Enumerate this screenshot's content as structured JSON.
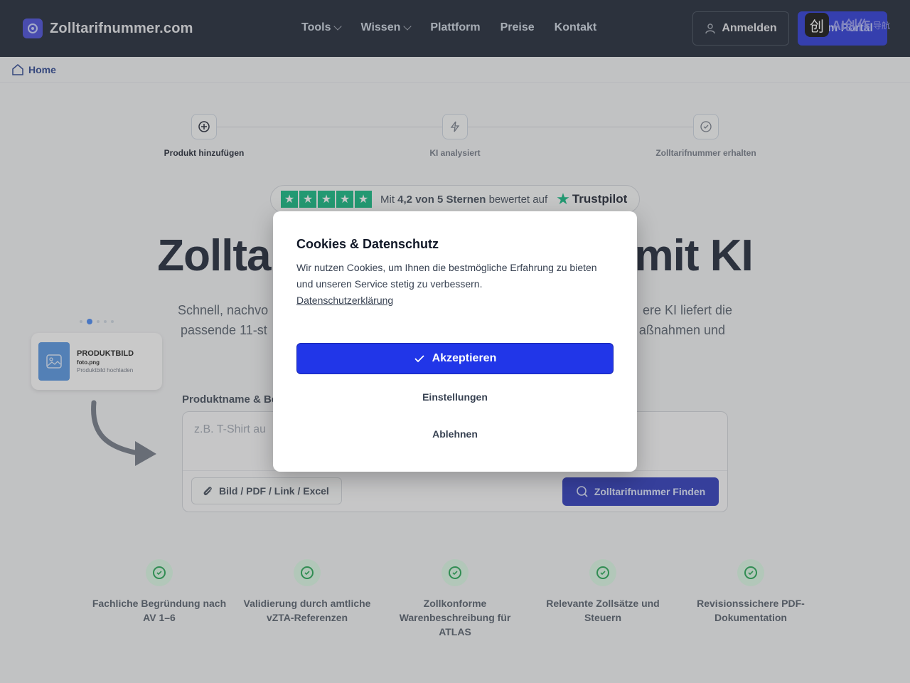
{
  "header": {
    "brand": "Zolltarifnummer.com",
    "nav": [
      {
        "label": "Tools",
        "has_dropdown": true
      },
      {
        "label": "Wissen",
        "has_dropdown": true
      },
      {
        "label": "Plattform",
        "has_dropdown": false
      },
      {
        "label": "Preise",
        "has_dropdown": false
      },
      {
        "label": "Kontakt",
        "has_dropdown": false
      }
    ],
    "login_label": "Anmelden",
    "portal_label": "m Portal",
    "watermark_text": "AI创作",
    "watermark_sub": "导航"
  },
  "breadcrumb": {
    "home": "Home"
  },
  "steps": [
    {
      "label": "Produkt hinzufügen",
      "icon": "plus-circle-icon",
      "active": true
    },
    {
      "label": "KI analysiert",
      "icon": "lightning-icon",
      "active": false
    },
    {
      "label": "Zolltarifnummer erhalten",
      "icon": "check-circle-icon",
      "active": false
    }
  ],
  "trustpilot": {
    "prefix": "Mit",
    "rating": "4,2 von 5 Sternen",
    "suffix": "bewertet auf",
    "brand": "Trustpilot",
    "stars": 5
  },
  "hero": {
    "title_left": "Zollta",
    "title_right": "mit KI",
    "sub_line1_left": "Schnell, nachvo",
    "sub_line1_right": "ere KI liefert die",
    "sub_line2_left": "passende 11-st",
    "sub_line2_right": "aßnahmen und"
  },
  "product_card": {
    "title": "PRODUKTBILD",
    "filename": "foto.png",
    "hint": "Produktbild hochladen",
    "carousel_dots": 5,
    "carousel_active": 1
  },
  "input": {
    "label": "Produktname & Be",
    "placeholder": "z.B. T-Shirt au",
    "attach_label": "Bild / PDF / Link / Excel",
    "find_label": "Zolltarifnummer Finden"
  },
  "features": [
    {
      "text": "Fachliche Begründung nach AV 1–6"
    },
    {
      "text": "Validierung durch amtliche vZTA-Referenzen"
    },
    {
      "text": "Zollkonforme Warenbeschreibung für ATLAS"
    },
    {
      "text": "Relevante Zollsätze und Steuern"
    },
    {
      "text": "Revisionssichere PDF-Dokumentation"
    }
  ],
  "cookie_modal": {
    "title": "Cookies & Datenschutz",
    "body": "Wir nutzen Cookies, um Ihnen die bestmögliche Erfahrung zu bieten und unseren Service stetig zu verbessern.",
    "link": "Datenschutzerklärung",
    "accept": "Akzeptieren",
    "settings": "Einstellungen",
    "reject": "Ablehnen"
  },
  "colors": {
    "header_bg": "#0f1729",
    "accent": "#2136e8",
    "trustpilot_green": "#00b67a",
    "success_green": "#16a34a"
  }
}
